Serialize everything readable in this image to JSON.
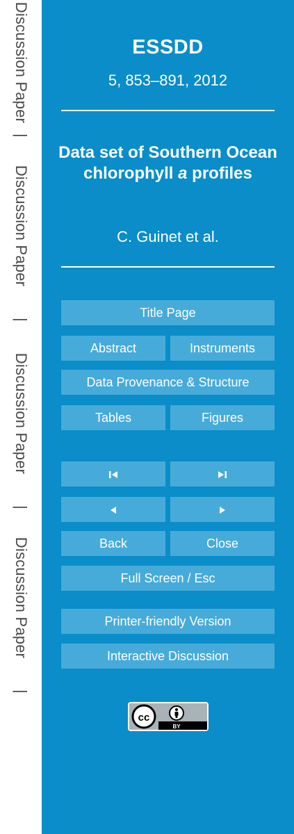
{
  "sidebar": {
    "items": [
      {
        "label": "Discussion Paper"
      },
      {
        "label": "|"
      },
      {
        "label": "Discussion Paper"
      },
      {
        "label": "|"
      },
      {
        "label": "Discussion Paper"
      },
      {
        "label": "|"
      },
      {
        "label": "Discussion Paper"
      },
      {
        "label": "|"
      }
    ]
  },
  "header": {
    "journal": "ESSDD",
    "citation": "5, 853–891, 2012",
    "title_part1": "Data set of Southern Ocean chlorophyll ",
    "title_italic": "a",
    "title_part2": " profiles",
    "authors": "C. Guinet et al."
  },
  "nav": {
    "title_page": "Title Page",
    "abstract": "Abstract",
    "instruments": "Instruments",
    "provenance": "Data Provenance & Structure",
    "tables": "Tables",
    "figures": "Figures",
    "back": "Back",
    "close": "Close",
    "fullscreen": "Full Screen / Esc",
    "printer": "Printer-friendly Version",
    "discussion": "Interactive Discussion"
  },
  "license": {
    "badge_text": "BY",
    "icon": "creative-commons-by-icon"
  },
  "colors": {
    "panel": "#0a8dc9",
    "button": "#47abd9",
    "strip_text": "#4a4a4a"
  }
}
